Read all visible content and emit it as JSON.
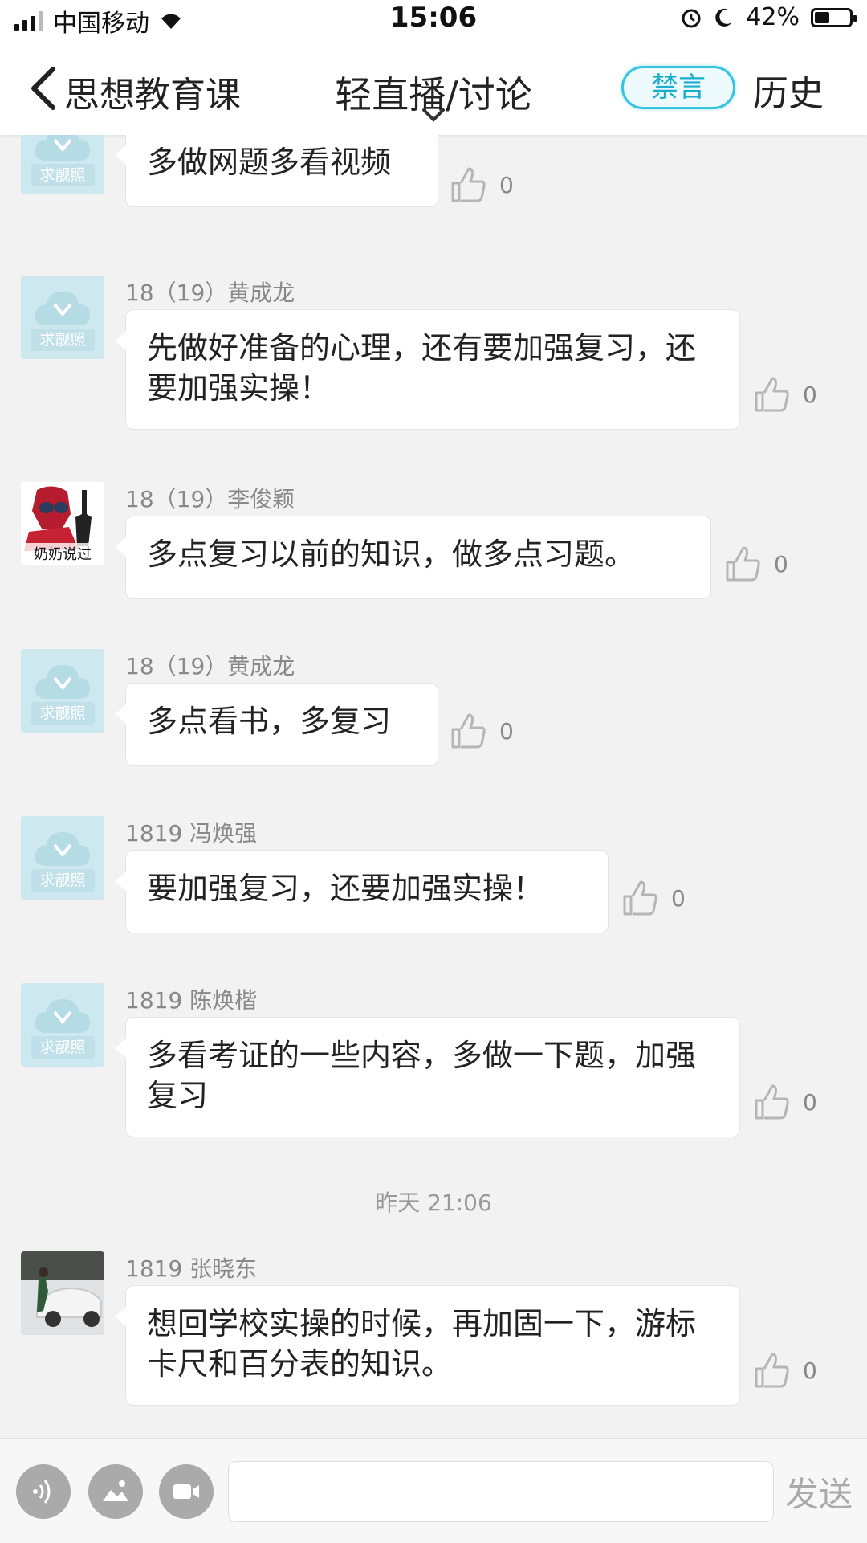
{
  "status_bar": {
    "carrier": "中国移动",
    "time": "15:06",
    "battery": "42%",
    "battery_level": 0.42,
    "icons": [
      "signal-icon",
      "wifi-icon",
      "alarm-icon",
      "moon-icon",
      "battery-icon"
    ]
  },
  "header": {
    "course": "思想教育课",
    "title": "轻直播/讨论",
    "mute": "禁言",
    "history": "历史",
    "accent_color": "#35c5e0"
  },
  "avatar_default_caption": "求靓照",
  "avatar_custom_caption": "奶奶说过",
  "messages": [
    {
      "sender": "",
      "text": "多做网题多看视频",
      "likes": "0",
      "avatar": "default"
    },
    {
      "sender": "18（19）黄成龙",
      "text": "先做好准备的心理，还有要加强复习，还要加强实操！",
      "likes": "0",
      "avatar": "default"
    },
    {
      "sender": "18（19）李俊颖",
      "text": "多点复习以前的知识，做多点习题。",
      "likes": "0",
      "avatar": "custom"
    },
    {
      "sender": "18（19）黄成龙",
      "text": "多点看书，多复习",
      "likes": "0",
      "avatar": "default"
    },
    {
      "sender": "1819 冯焕强",
      "text": "要加强复习，还要加强实操！",
      "likes": "0",
      "avatar": "default"
    },
    {
      "sender": "1819 陈焕楷",
      "text": "多看考证的一些内容，多做一下题，加强复习",
      "likes": "0",
      "avatar": "default"
    },
    {
      "sender": "1819 张晓东",
      "text": "想回学校实操的时候，再加固一下，游标卡尺和百分表的知识。",
      "likes": "0",
      "avatar": "photo"
    }
  ],
  "timestamp": "昨天 21:06",
  "input": {
    "placeholder": "",
    "send": "发送",
    "buttons": [
      "voice-icon",
      "image-icon",
      "video-icon"
    ]
  }
}
